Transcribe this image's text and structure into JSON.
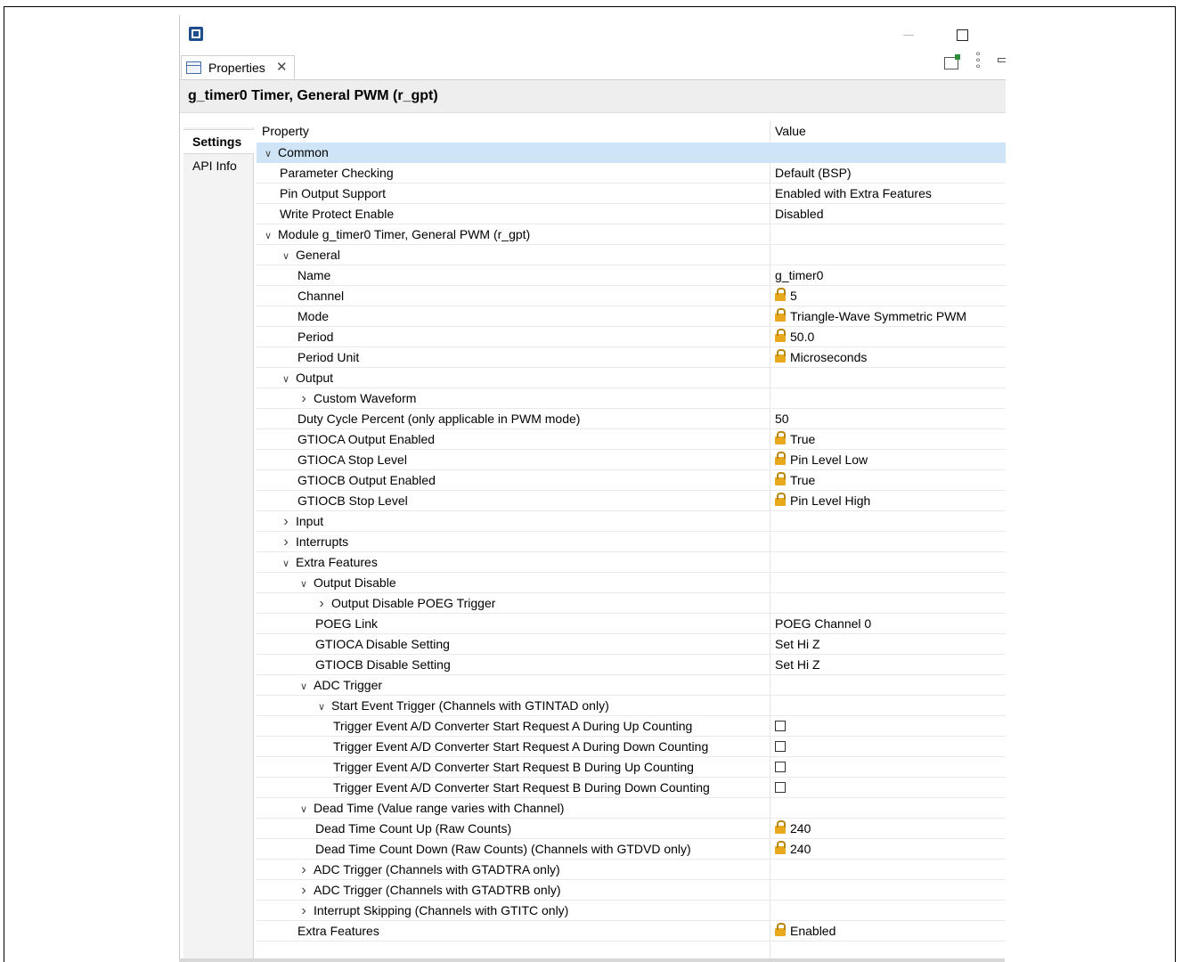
{
  "window": {
    "tab_label": "Properties",
    "close_glyph": "✕",
    "title": "g_timer0 Timer, General PWM (r_gpt)"
  },
  "side_tabs": [
    {
      "label": "Settings",
      "active": true
    },
    {
      "label": "API Info",
      "active": false
    }
  ],
  "table": {
    "col_property": "Property",
    "col_value": "Value",
    "rows": [
      {
        "indent": 0,
        "tw": "v",
        "label": "Common",
        "value": "",
        "lock": false,
        "selected": true
      },
      {
        "indent": 1,
        "tw": "",
        "label": "Parameter Checking",
        "value": "Default (BSP)",
        "lock": false
      },
      {
        "indent": 1,
        "tw": "",
        "label": "Pin Output Support",
        "value": "Enabled with Extra Features",
        "lock": false
      },
      {
        "indent": 1,
        "tw": "",
        "label": "Write Protect Enable",
        "value": "Disabled",
        "lock": false
      },
      {
        "indent": 0,
        "tw": "v",
        "label": "Module g_timer0 Timer, General PWM (r_gpt)",
        "value": "",
        "lock": false
      },
      {
        "indent": 1,
        "tw": "v",
        "label": "General",
        "value": "",
        "lock": false
      },
      {
        "indent": 2,
        "tw": "",
        "label": "Name",
        "value": "g_timer0",
        "lock": false
      },
      {
        "indent": 2,
        "tw": "",
        "label": "Channel",
        "value": "5",
        "lock": true
      },
      {
        "indent": 2,
        "tw": "",
        "label": "Mode",
        "value": "Triangle-Wave Symmetric PWM",
        "lock": true
      },
      {
        "indent": 2,
        "tw": "",
        "label": "Period",
        "value": "50.0",
        "lock": true
      },
      {
        "indent": 2,
        "tw": "",
        "label": "Period Unit",
        "value": "Microseconds",
        "lock": true
      },
      {
        "indent": 1,
        "tw": "v",
        "label": "Output",
        "value": "",
        "lock": false
      },
      {
        "indent": 2,
        "tw": ">",
        "label": "Custom Waveform",
        "value": "",
        "lock": false
      },
      {
        "indent": 2,
        "tw": "",
        "label": "Duty Cycle Percent (only applicable in PWM mode)",
        "value": "50",
        "lock": false
      },
      {
        "indent": 2,
        "tw": "",
        "label": "GTIOCA Output Enabled",
        "value": "True",
        "lock": true
      },
      {
        "indent": 2,
        "tw": "",
        "label": "GTIOCA Stop Level",
        "value": "Pin Level Low",
        "lock": true
      },
      {
        "indent": 2,
        "tw": "",
        "label": "GTIOCB Output Enabled",
        "value": "True",
        "lock": true
      },
      {
        "indent": 2,
        "tw": "",
        "label": "GTIOCB Stop Level",
        "value": "Pin Level High",
        "lock": true
      },
      {
        "indent": 1,
        "tw": ">",
        "label": "Input",
        "value": "",
        "lock": false
      },
      {
        "indent": 1,
        "tw": ">",
        "label": "Interrupts",
        "value": "",
        "lock": false
      },
      {
        "indent": 1,
        "tw": "v",
        "label": "Extra Features",
        "value": "",
        "lock": false
      },
      {
        "indent": 2,
        "tw": "v",
        "label": "Output Disable",
        "value": "",
        "lock": false
      },
      {
        "indent": 3,
        "tw": ">",
        "label": "Output Disable POEG Trigger",
        "value": "",
        "lock": false
      },
      {
        "indent": 3,
        "tw": "",
        "label": "POEG Link",
        "value": "POEG Channel 0",
        "lock": false
      },
      {
        "indent": 3,
        "tw": "",
        "label": "GTIOCA Disable Setting",
        "value": "Set Hi Z",
        "lock": false
      },
      {
        "indent": 3,
        "tw": "",
        "label": "GTIOCB Disable Setting",
        "value": "Set Hi Z",
        "lock": false
      },
      {
        "indent": 2,
        "tw": "v",
        "label": "ADC Trigger",
        "value": "",
        "lock": false
      },
      {
        "indent": 3,
        "tw": "v",
        "label": "Start Event Trigger (Channels with GTINTAD only)",
        "value": "",
        "lock": false
      },
      {
        "indent": 4,
        "tw": "",
        "label": "Trigger Event A/D Converter Start Request A During Up Counting",
        "value": "",
        "lock": false,
        "checkbox": true
      },
      {
        "indent": 4,
        "tw": "",
        "label": "Trigger Event A/D Converter Start Request A During Down Counting",
        "value": "",
        "lock": false,
        "checkbox": true
      },
      {
        "indent": 4,
        "tw": "",
        "label": "Trigger Event A/D Converter Start Request B During Up Counting",
        "value": "",
        "lock": false,
        "checkbox": true
      },
      {
        "indent": 4,
        "tw": "",
        "label": "Trigger Event A/D Converter Start Request B During Down Counting",
        "value": "",
        "lock": false,
        "checkbox": true
      },
      {
        "indent": 2,
        "tw": "v",
        "label": "Dead Time (Value range varies with Channel)",
        "value": "",
        "lock": false
      },
      {
        "indent": 3,
        "tw": "",
        "label": "Dead Time Count Up (Raw Counts)",
        "value": "240",
        "lock": true
      },
      {
        "indent": 3,
        "tw": "",
        "label": "Dead Time Count Down (Raw Counts) (Channels with GTDVD only)",
        "value": "240",
        "lock": true
      },
      {
        "indent": 2,
        "tw": ">",
        "label": "ADC Trigger (Channels with GTADTRA only)",
        "value": "",
        "lock": false
      },
      {
        "indent": 2,
        "tw": ">",
        "label": "ADC Trigger (Channels with GTADTRB only)",
        "value": "",
        "lock": false
      },
      {
        "indent": 2,
        "tw": ">",
        "label": "Interrupt Skipping (Channels with GTITC only)",
        "value": "",
        "lock": false
      },
      {
        "indent": 2,
        "tw": "",
        "label": "Extra Features",
        "value": "Enabled",
        "lock": true
      }
    ]
  }
}
